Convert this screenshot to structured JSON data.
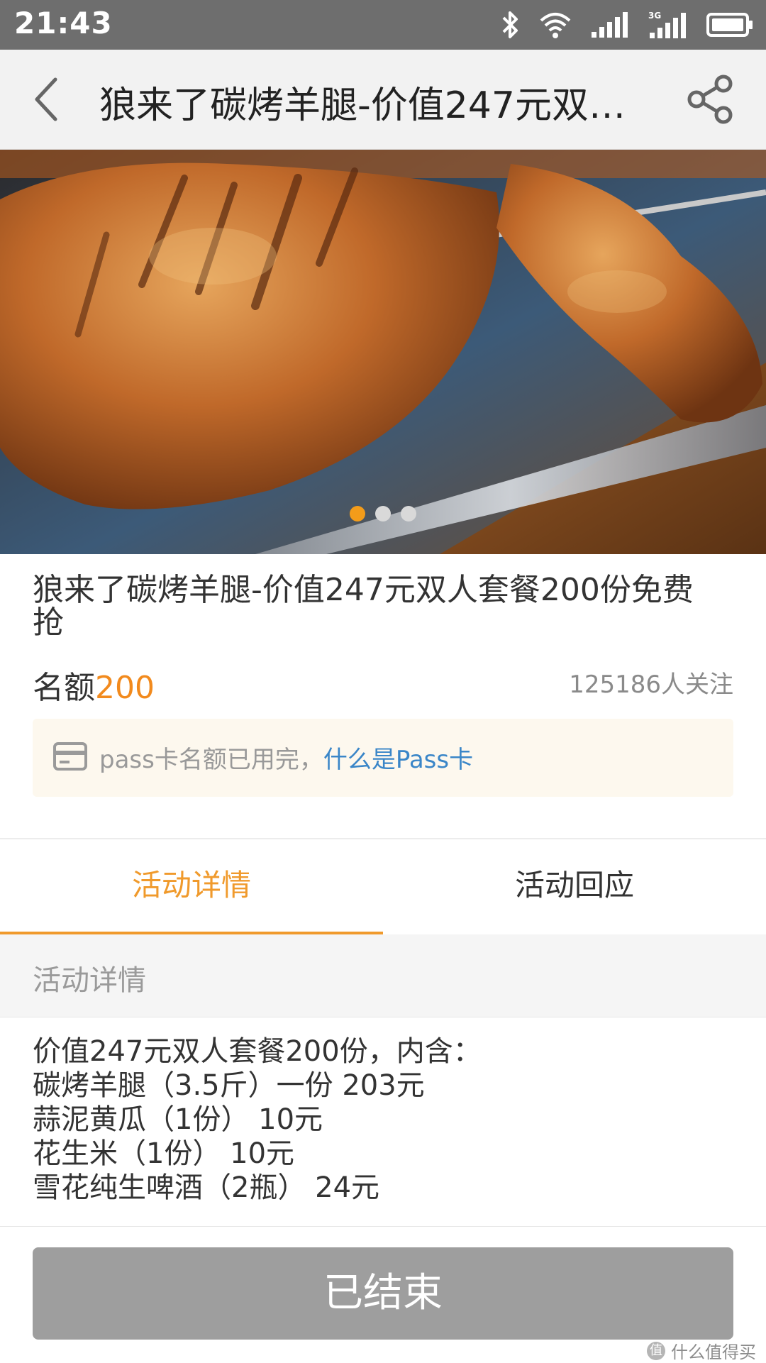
{
  "status_bar": {
    "time": "21:43",
    "icons": [
      "bluetooth-icon",
      "wifi-icon",
      "signal-icon",
      "signal-3g-icon",
      "battery-icon"
    ],
    "network_label": "3G"
  },
  "app_bar": {
    "title": "狼来了碳烤羊腿-价值247元双人套餐200份免费抢",
    "back_icon": "back-arrow-icon",
    "share_icon": "share-icon"
  },
  "carousel": {
    "image_subject": "roast lamb leg",
    "page_count": 3,
    "active_index": 0
  },
  "product": {
    "name": "狼来了碳烤羊腿-价值247元双人套餐200份免费抢",
    "quota_label": "名额",
    "quota_value": "200",
    "followers": "125186人关注",
    "pass_notice": "pass卡名额已用完，",
    "pass_link": "什么是Pass卡"
  },
  "tabs": {
    "detail": "活动详情",
    "reply": "活动回应",
    "active": "detail"
  },
  "section": {
    "heading": "活动详情",
    "lines": [
      "价值247元双人套餐200份，内含：",
      "碳烤羊腿（3.5斤）一份 203元",
      "蒜泥黄瓜（1份） 10元",
      "花生米（1份） 10元",
      "雪花纯生啤酒（2瓶） 24元"
    ]
  },
  "footer": {
    "ended_label": "已结束",
    "watermark": "什么值得买"
  },
  "colors": {
    "accent": "#f09a2c",
    "quota": "#f28a1d",
    "link": "#3a86c8",
    "status_bar": "#6e6e6e",
    "disabled_button": "#9e9e9e"
  }
}
